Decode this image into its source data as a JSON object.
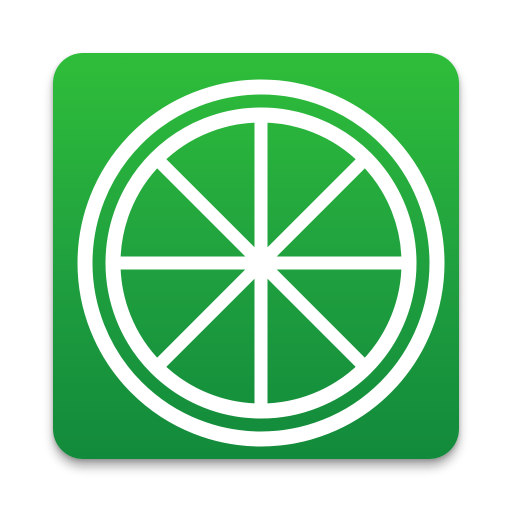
{
  "app_icon": {
    "icon": "lime-slice-icon",
    "background_color_top": "#2fbe3a",
    "background_color_bottom": "#128a3b",
    "symbol_color": "#ffffff",
    "segments": 8
  }
}
